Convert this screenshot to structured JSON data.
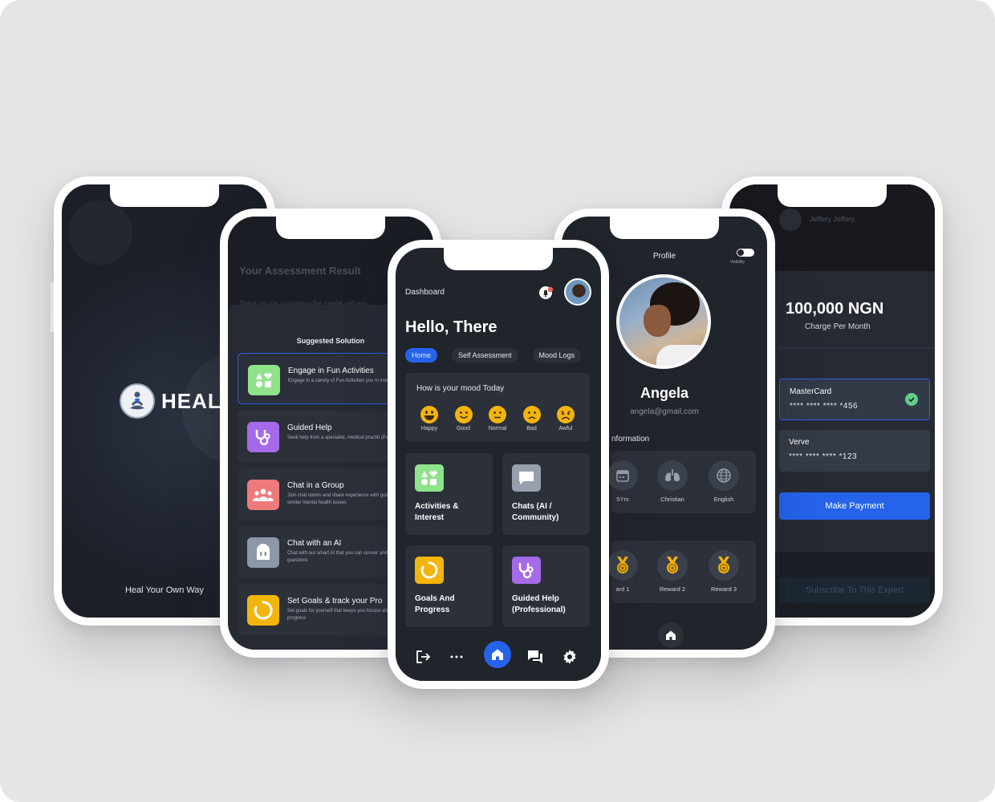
{
  "splash": {
    "logo_text": "HEAL",
    "tagline": "Heal Your Own Way"
  },
  "assessment": {
    "title": "Your Assessment Result",
    "subtitle": "Thank you for completing the mental self-ass",
    "sheet_title": "Suggested Solution",
    "solutions": [
      {
        "title": "Engage in Fun Activities",
        "desc": "Engage in a variety of Fun Activities you m interested in",
        "icon": "shapes-icon",
        "color": "#8fe38a"
      },
      {
        "title": "Guided Help",
        "desc": "Seek help from a specialist, medical practiti (Psychiatrist)",
        "icon": "stethoscope-icon",
        "color": "#a66ae8"
      },
      {
        "title": "Chat in a Group",
        "desc": "Join chat rooms and share experience with going through similar mental health issues",
        "icon": "group-icon",
        "color": "#ef7a7a"
      },
      {
        "title": "Chat with an AI",
        "desc": "Chat with our smart AI that you can conver and ask questions",
        "icon": "robot-icon",
        "color": "#8e97a8"
      },
      {
        "title": "Set Goals & track your Pro",
        "desc": "Set goals for yourself that keeps you focuse also track your progress",
        "icon": "progress-icon",
        "color": "#f3b40c"
      }
    ]
  },
  "dashboard": {
    "header_label": "Dashboard",
    "greeting": "Hello, There",
    "tabs": [
      {
        "label": "Home",
        "active": true
      },
      {
        "label": "Self Assessment",
        "active": false
      },
      {
        "label": "Mood Logs",
        "active": false
      }
    ],
    "mood_question": "How is your mood Today",
    "moods": [
      {
        "label": "Happy",
        "icon": "happy-face-icon"
      },
      {
        "label": "Good",
        "icon": "good-face-icon"
      },
      {
        "label": "Normal",
        "icon": "neutral-face-icon"
      },
      {
        "label": "Bad",
        "icon": "bad-face-icon"
      },
      {
        "label": "Awful",
        "icon": "awful-face-icon"
      }
    ],
    "tiles": [
      {
        "label": "Activities & Interest",
        "icon": "shapes-icon",
        "color": "#8fe38a"
      },
      {
        "label": "Chats (AI / Community)",
        "icon": "chat-bubble-icon",
        "color": "#98a0ad"
      },
      {
        "label": "Goals And Progress",
        "icon": "progress-icon",
        "color": "#f3b40c"
      },
      {
        "label": "Guided Help (Professional)",
        "icon": "stethoscope-icon",
        "color": "#a66ae8"
      }
    ],
    "nav": [
      "logout-icon",
      "more-icon",
      "home-icon",
      "chat-icon",
      "settings-icon"
    ],
    "accent": "#2563eb"
  },
  "profile": {
    "title": "Profile",
    "visibility_label": "Visibility",
    "name": "Angela",
    "email": "angela@gmail.com",
    "info_label": "nformation",
    "info": [
      {
        "label": "5Yrs",
        "icon": "calendar-icon"
      },
      {
        "label": "Christian",
        "icon": "lungs-icon"
      },
      {
        "label": "English",
        "icon": "globe-icon"
      }
    ],
    "rewards": [
      {
        "label": "ard 1",
        "icon": "medal-icon"
      },
      {
        "label": "Reward 2",
        "icon": "medal-icon"
      },
      {
        "label": "Reward 3",
        "icon": "medal-icon"
      }
    ]
  },
  "payment": {
    "user": "Jeffery Jeffery",
    "amount": "100,000 NGN",
    "period": "Charge Per Month",
    "cards": [
      {
        "name": "MasterCard",
        "number": "**** **** **** *456",
        "selected": true
      },
      {
        "name": "Verve",
        "number": "**** **** **** *123",
        "selected": false
      }
    ],
    "pay_button": "Make Payment",
    "subscribe_button": "Subscribe To This Expert"
  }
}
